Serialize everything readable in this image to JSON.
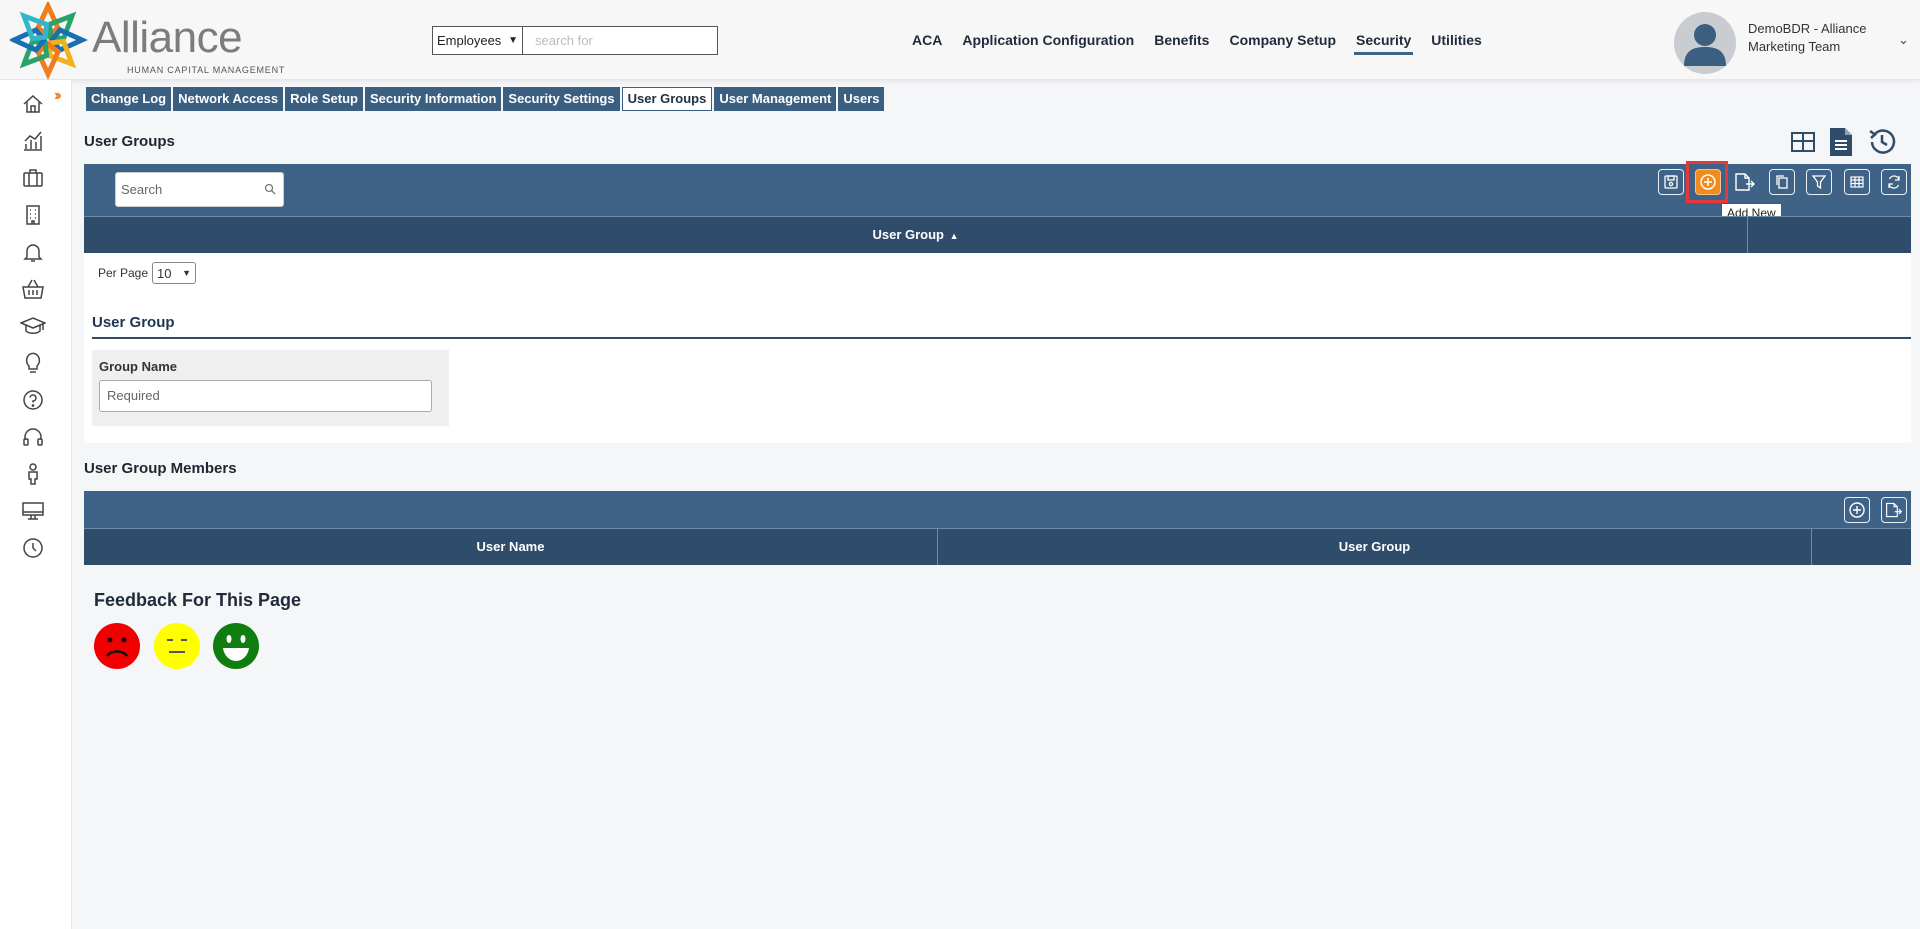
{
  "header": {
    "logo_text": "Alliance",
    "logo_subtitle": "HUMAN CAPITAL MANAGEMENT",
    "search_scope": "Employees",
    "search_placeholder": "search for",
    "nav": [
      {
        "label": "ACA",
        "active": false
      },
      {
        "label": "Application Configuration",
        "active": false
      },
      {
        "label": "Benefits",
        "active": false
      },
      {
        "label": "Company Setup",
        "active": false
      },
      {
        "label": "Security",
        "active": true
      },
      {
        "label": "Utilities",
        "active": false
      }
    ],
    "profile_name": "DemoBDR - Alliance Marketing Team"
  },
  "sidebar": {
    "icons": [
      "home-icon",
      "chart-icon",
      "briefcase-icon",
      "building-icon",
      "bell-icon",
      "basket-icon",
      "graduation-cap-icon",
      "lightbulb-icon",
      "help-icon",
      "headset-icon",
      "person-icon",
      "monitor-icon",
      "clock-icon"
    ]
  },
  "subtabs": [
    {
      "label": "Change Log",
      "active": false
    },
    {
      "label": "Network Access",
      "active": false
    },
    {
      "label": "Role Setup",
      "active": false
    },
    {
      "label": "Security Information",
      "active": false
    },
    {
      "label": "Security Settings",
      "active": false
    },
    {
      "label": "User Groups",
      "active": true
    },
    {
      "label": "User Management",
      "active": false
    },
    {
      "label": "Users",
      "active": false
    }
  ],
  "page": {
    "title": "User Groups"
  },
  "grid": {
    "search_placeholder": "Search",
    "column_header": "User Group",
    "sort_indicator": "▲",
    "tooltip": "Add New",
    "per_page_label": "Per Page",
    "per_page_value": "10"
  },
  "form": {
    "title": "User Group",
    "field_label": "Group Name",
    "field_placeholder": "Required"
  },
  "members": {
    "title": "User Group Members",
    "columns": [
      "User Name",
      "User Group"
    ]
  },
  "feedback": {
    "title": "Feedback For This Page",
    "colors": {
      "sad": "#f00000",
      "neutral": "#ffff00",
      "happy": "#0f7d0f"
    }
  },
  "colors": {
    "toolbar": "#3f6386",
    "header_row": "#2f4d6b",
    "accent_orange": "#f28a1d",
    "highlight_red": "#e23a3a"
  }
}
